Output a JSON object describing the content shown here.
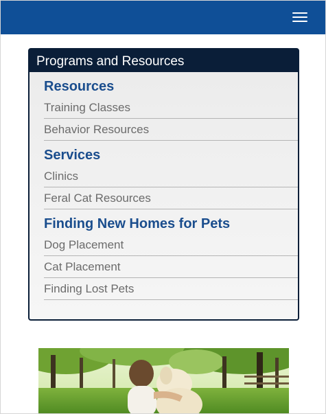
{
  "colors": {
    "header_bar": "#0f4f97",
    "panel_header": "#0a1e38",
    "section_heading": "#1a4d8d",
    "link_text": "#6b6b6b"
  },
  "header": {
    "menu_icon": "hamburger-menu-icon"
  },
  "panel": {
    "title": "Programs and Resources",
    "sections": [
      {
        "heading": "Resources",
        "items": [
          "Training Classes",
          "Behavior Resources"
        ]
      },
      {
        "heading": "Services",
        "items": [
          "Clinics",
          "Feral Cat Resources"
        ]
      },
      {
        "heading": "Finding New Homes for Pets",
        "items": [
          "Dog Placement",
          "Cat Placement",
          "Finding Lost Pets"
        ]
      }
    ]
  },
  "hero_image": {
    "subject": "child hugging a dog in a park"
  }
}
